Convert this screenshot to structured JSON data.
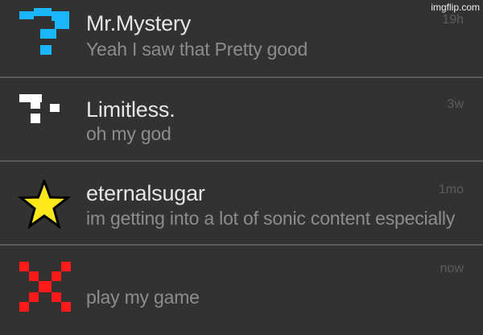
{
  "watermark": "imgflip.com",
  "messages": [
    {
      "name": "Mr.Mystery",
      "preview": "Yeah I saw that Pretty good",
      "time": "19h",
      "avatar_icon": "pixel-question-mark-icon",
      "avatar_color": "#1ab6ff"
    },
    {
      "name": "Limitless.",
      "preview": "oh my god",
      "time": "3w",
      "avatar_icon": "pixel-broken-glyph-icon",
      "avatar_color": "#ffffff"
    },
    {
      "name": "eternalsugar",
      "preview": "im getting into a lot of sonic content especially",
      "time": "1mo",
      "avatar_icon": "yellow-star-icon",
      "avatar_color": "#ffe81a"
    },
    {
      "name": "",
      "preview": "play my game",
      "time": "now",
      "avatar_icon": "pixel-red-x-icon",
      "avatar_color": "#ff1a1a"
    }
  ]
}
